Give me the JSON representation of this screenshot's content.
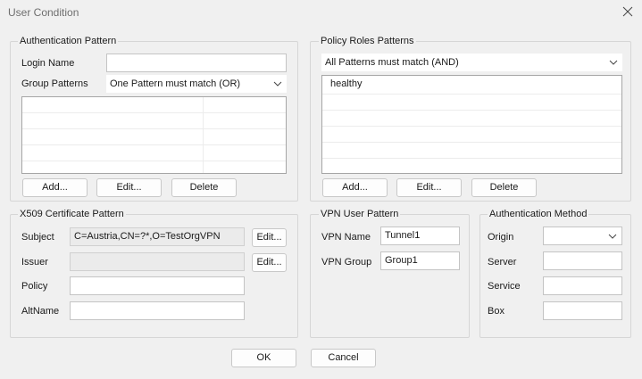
{
  "window": {
    "title": "User Condition",
    "close_icon": "close-icon"
  },
  "auth_pattern": {
    "legend": "Authentication Pattern",
    "login_name_label": "Login Name",
    "login_name_value": "",
    "group_patterns_label": "Group Patterns",
    "group_patterns_selected": "One Pattern must match (OR)",
    "group_rows": [
      "",
      "",
      "",
      "",
      ""
    ],
    "add_label": "Add...",
    "edit_label": "Edit...",
    "delete_label": "Delete"
  },
  "policy_roles": {
    "legend": "Policy Roles Patterns",
    "mode_selected": "All Patterns must match (AND)",
    "items": [
      "healthy"
    ],
    "add_label": "Add...",
    "edit_label": "Edit...",
    "delete_label": "Delete"
  },
  "x509": {
    "legend": "X509 Certificate Pattern",
    "subject_label": "Subject",
    "subject_value": "C=Austria,CN=?*,O=TestOrgVPN",
    "subject_edit_label": "Edit...",
    "issuer_label": "Issuer",
    "issuer_value": "",
    "issuer_edit_label": "Edit...",
    "policy_label": "Policy",
    "policy_value": "",
    "altname_label": "AltName",
    "altname_value": ""
  },
  "vpn_user": {
    "legend": "VPN User Pattern",
    "name_label": "VPN Name",
    "name_value": "Tunnel1",
    "group_label": "VPN Group",
    "group_value": "Group1"
  },
  "auth_method": {
    "legend": "Authentication Method",
    "origin_label": "Origin",
    "origin_selected": "",
    "server_label": "Server",
    "server_value": "",
    "service_label": "Service",
    "service_value": "",
    "box_label": "Box",
    "box_value": ""
  },
  "footer": {
    "ok_label": "OK",
    "cancel_label": "Cancel"
  }
}
